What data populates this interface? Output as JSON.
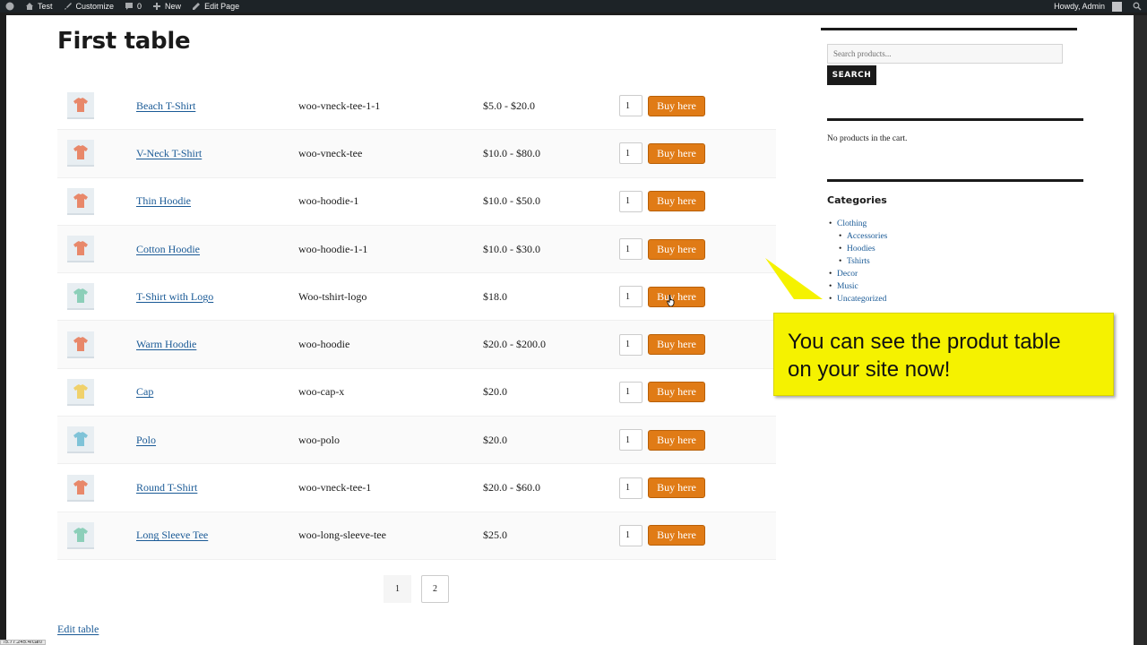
{
  "adminbar": {
    "site_name": "Test",
    "customize": "Customize",
    "comments_count": "0",
    "new": "New",
    "edit_page": "Edit Page",
    "howdy": "Howdy, Admin"
  },
  "page": {
    "title": "First table",
    "edit_table": "Edit table"
  },
  "table": {
    "buy_label": "Buy here",
    "rows": [
      {
        "name": "Beach T-Shirt",
        "sku": "woo-vneck-tee-1-1",
        "price": "$5.0 - $20.0",
        "qty": "1",
        "thumb_color": "#e8886a"
      },
      {
        "name": "V-Neck T-Shirt",
        "sku": "woo-vneck-tee",
        "price": "$10.0 - $80.0",
        "qty": "1",
        "thumb_color": "#e8886a"
      },
      {
        "name": "Thin Hoodie",
        "sku": "woo-hoodie-1",
        "price": "$10.0 - $50.0",
        "qty": "1",
        "thumb_color": "#e8886a"
      },
      {
        "name": "Cotton Hoodie",
        "sku": "woo-hoodie-1-1",
        "price": "$10.0 - $30.0",
        "qty": "1",
        "thumb_color": "#e8886a"
      },
      {
        "name": "T-Shirt with Logo",
        "sku": "Woo-tshirt-logo",
        "price": "$18.0",
        "qty": "1",
        "thumb_color": "#8ccfb9"
      },
      {
        "name": "Warm Hoodie",
        "sku": "woo-hoodie",
        "price": "$20.0 - $200.0",
        "qty": "1",
        "thumb_color": "#e8886a"
      },
      {
        "name": "Cap",
        "sku": "woo-cap-x",
        "price": "$20.0",
        "qty": "1",
        "thumb_color": "#f0d16b"
      },
      {
        "name": "Polo",
        "sku": "woo-polo",
        "price": "$20.0",
        "qty": "1",
        "thumb_color": "#7fc3d8"
      },
      {
        "name": "Round T-Shirt",
        "sku": "woo-vneck-tee-1",
        "price": "$20.0 - $60.0",
        "qty": "1",
        "thumb_color": "#e8886a"
      },
      {
        "name": "Long Sleeve Tee",
        "sku": "woo-long-sleeve-tee",
        "price": "$25.0",
        "qty": "1",
        "thumb_color": "#8ccfb9"
      }
    ]
  },
  "pagination": {
    "pages": [
      "1",
      "2"
    ],
    "current": "1"
  },
  "sidebar": {
    "search_placeholder": "Search products...",
    "search_button": "SEARCH",
    "cart_empty": "No products in the cart.",
    "categories_title": "Categories",
    "categories": [
      {
        "label": "Clothing",
        "level": 0
      },
      {
        "label": "Accessories",
        "level": 1
      },
      {
        "label": "Hoodies",
        "level": 1
      },
      {
        "label": "Tshirts",
        "level": 1
      },
      {
        "label": "Decor",
        "level": 0
      },
      {
        "label": "Music",
        "level": 0
      },
      {
        "label": "Uncategorized",
        "level": 0
      }
    ]
  },
  "callout": {
    "line1": "You can see the produt table",
    "line2": "on your site now!"
  },
  "statusbar": {
    "url": "/5.77.245.4/cart/"
  },
  "colors": {
    "accent_button": "#e07b16",
    "link": "#1a5a96",
    "callout_bg": "#f5f200",
    "adminbar_bg": "#1d2327"
  }
}
